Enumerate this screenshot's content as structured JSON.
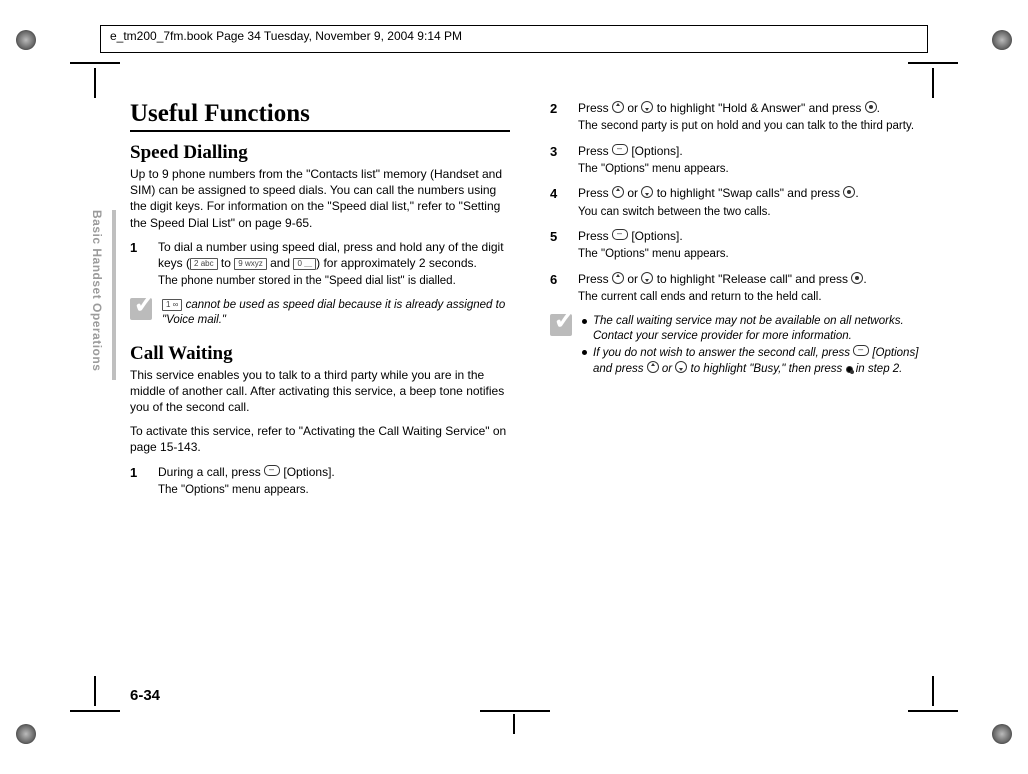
{
  "header": "e_tm200_7fm.book  Page 34  Tuesday, November 9, 2004  9:14 PM",
  "sidelabel": "Basic Handset Operations",
  "pagenum": "6-34",
  "left": {
    "h1": "Useful Functions",
    "h2a": "Speed Dialling",
    "p1": "Up to 9 phone numbers from the \"Contacts list\" memory (Handset and SIM) can be assigned to speed dials. You can call the numbers using the digit keys. For information on the \"Speed dial list,\" refer to \"Setting the Speed Dial List\" on page 9-65.",
    "step1_main_a": "To dial a number using speed dial, press and hold any of the digit keys (",
    "key2": "2 abc",
    "step1_main_b": " to ",
    "key9": "9 wxyz",
    "step1_main_c": " and ",
    "key0": "0 ＿",
    "step1_main_d": ") for approximately 2 seconds.",
    "step1_sub": "The phone number stored in the \"Speed dial list\" is dialled.",
    "note1_key": "1 ∞",
    "note1_text": " cannot be used as speed dial because it is already assigned to \"Voice mail.\"",
    "h2b": "Call Waiting",
    "p2": "This service enables you to talk to a third party while you are in the middle of another call. After activating this service, a beep tone notifies you of the second call.",
    "p3": "To activate this service, refer to \"Activating the Call Waiting Service\" on page 15-143.",
    "stepB1_main_a": "During a call, press ",
    "stepB1_main_b": " [Options].",
    "stepB1_sub": "The \"Options\" menu appears."
  },
  "right": {
    "s2_a": "Press ",
    "s2_b": " or ",
    "s2_c": " to highlight \"Hold & Answer\" and press ",
    "s2_d": ".",
    "s2_sub": "The second party is put on hold and you can talk to the third party.",
    "s3_a": "Press ",
    "s3_b": " [Options].",
    "s3_sub": "The \"Options\" menu appears.",
    "s4_a": "Press ",
    "s4_b": " or ",
    "s4_c": " to highlight \"Swap calls\" and press ",
    "s4_d": ".",
    "s4_sub": "You can switch between the two calls.",
    "s5_a": "Press ",
    "s5_b": " [Options].",
    "s5_sub": "The \"Options\" menu appears.",
    "s6_a": "Press ",
    "s6_b": " or ",
    "s6_c": " to highlight \"Release call\" and press ",
    "s6_d": ".",
    "s6_sub": "The current call ends and return to the held call.",
    "note_b1": "The call waiting service may not be available on all networks. Contact your service provider for more information.",
    "note_b2_a": "If you do not wish to answer the second call, press ",
    "note_b2_b": " [Options] and press ",
    "note_b2_c": " or ",
    "note_b2_d": " to highlight \"Busy,\" then press ",
    "note_b2_e": " in step 2."
  }
}
